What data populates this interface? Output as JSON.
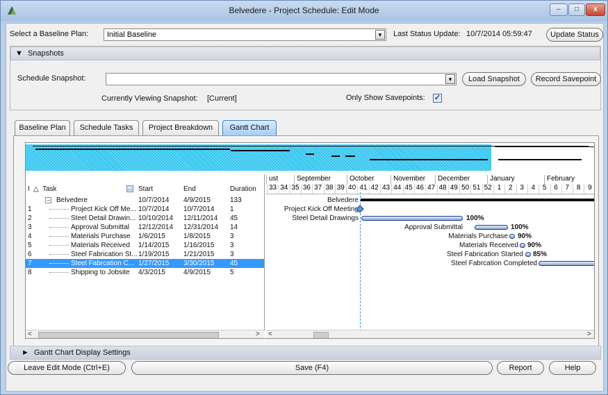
{
  "window": {
    "title": "Belvedere - Project Schedule: Edit Mode",
    "min_label": "–",
    "max_label": "□",
    "close_label": "x"
  },
  "baseline": {
    "label": "Select a Baseline Plan:",
    "value": "Initial Baseline",
    "status_label": "Last Status Update:",
    "status_value": "10/7/2014 05:59:47",
    "update_button": "Update Status"
  },
  "snapshots": {
    "section_label": "Snapshots",
    "schedule_label": "Schedule Snapshot:",
    "schedule_value": "",
    "load_button": "Load Snapshot",
    "record_button": "Record Savepoint",
    "viewing_label": "Currently Viewing Snapshot:",
    "viewing_value": "[Current]",
    "only_savepoints_label": "Only Show Savepoints:",
    "only_savepoints_checked": true
  },
  "tabs": [
    {
      "label": "Baseline Plan",
      "active": false
    },
    {
      "label": "Schedule Tasks",
      "active": false
    },
    {
      "label": "Project Breakdown",
      "active": false
    },
    {
      "label": "Gantt Chart",
      "active": true
    }
  ],
  "grid": {
    "headers": {
      "id": "I",
      "sort": "△",
      "task": "Task",
      "start": "Start",
      "end": "End",
      "duration": "Duration"
    },
    "rows": [
      {
        "id": "",
        "task": "Belvedere",
        "start": "10/7/2014",
        "end": "4/9/2015",
        "duration": "133",
        "selected": false,
        "level": 0
      },
      {
        "id": "1",
        "task": "Project Kick Off Me...",
        "start": "10/7/2014",
        "end": "10/7/2014",
        "duration": "1",
        "selected": false,
        "level": 1
      },
      {
        "id": "2",
        "task": "Steel Detail Drawin...",
        "start": "10/10/2014",
        "end": "12/11/2014",
        "duration": "45",
        "selected": false,
        "level": 1
      },
      {
        "id": "3",
        "task": "Approval Submittal",
        "start": "12/12/2014",
        "end": "12/31/2014",
        "duration": "14",
        "selected": false,
        "level": 1
      },
      {
        "id": "4",
        "task": "Materials Purchase",
        "start": "1/6/2015",
        "end": "1/8/2015",
        "duration": "3",
        "selected": false,
        "level": 1
      },
      {
        "id": "5",
        "task": "Materials Received",
        "start": "1/14/2015",
        "end": "1/16/2015",
        "duration": "3",
        "selected": false,
        "level": 1
      },
      {
        "id": "6",
        "task": "Steel Fabrication St...",
        "start": "1/19/2015",
        "end": "1/21/2015",
        "duration": "3",
        "selected": false,
        "level": 1
      },
      {
        "id": "7",
        "task": "Steel Fabrcation C...",
        "start": "1/27/2015",
        "end": "3/30/2015",
        "duration": "45",
        "selected": true,
        "level": 1
      },
      {
        "id": "8",
        "task": "Shipping to Jobsite",
        "start": "4/3/2015",
        "end": "4/9/2015",
        "duration": "5",
        "selected": false,
        "level": 1
      }
    ]
  },
  "gantt": {
    "months": [
      "ust",
      "September",
      "October",
      "November",
      "December",
      "January",
      "February"
    ],
    "weeks": [
      "33",
      "34",
      "35",
      "36",
      "37",
      "38",
      "39",
      "40",
      "41",
      "42",
      "43",
      "44",
      "45",
      "46",
      "47",
      "48",
      "49",
      "50",
      "51",
      "52",
      "1",
      "2",
      "3",
      "4",
      "5",
      "6",
      "7",
      "8",
      "9"
    ],
    "labels": [
      "Belvedere",
      "Project Kick Off Meeting",
      "Steel Detail Drawings",
      "Approval Submittal",
      "Materials Purchase",
      "Materials Received",
      "Steel Fabrication Started",
      "Steel Fabrcation Completed"
    ],
    "percents": [
      "100%",
      "100%",
      "90%",
      "90%",
      "85%"
    ]
  },
  "display_settings": {
    "label": "Gantt Chart Display Settings"
  },
  "footer": {
    "leave_button": "Leave Edit Mode (Ctrl+E)",
    "save_button": "Save (F4)",
    "report_button": "Report",
    "help_button": "Help"
  },
  "colors": {
    "accent": "#3399ff",
    "overview": "#32c6f0",
    "today_line": "#3d8fe0"
  }
}
